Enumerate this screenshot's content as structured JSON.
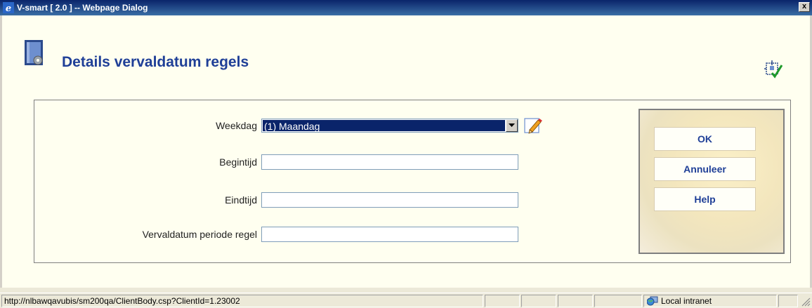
{
  "window": {
    "title": "V-smart [ 2.0 ] -- Webpage Dialog",
    "close_label": "x"
  },
  "page": {
    "title": "Details vervaldatum regels"
  },
  "form": {
    "weekdag": {
      "label": "Weekdag",
      "value": "(1) Maandag"
    },
    "begintijd": {
      "label": "Begintijd",
      "value": ""
    },
    "eindtijd": {
      "label": "Eindtijd",
      "value": ""
    },
    "periode": {
      "label": "Vervaldatum periode regel",
      "value": ""
    }
  },
  "buttons": {
    "ok": "OK",
    "annuleer": "Annuleer",
    "help": "Help"
  },
  "statusbar": {
    "url": "http://nlbawqavubis/sm200qa/ClientBody.csp?ClientId=1.23002",
    "zone": "Local intranet"
  },
  "icons": {
    "window": "ie-icon",
    "header": "settings-book-icon",
    "tool": "layout-check-icon",
    "edit": "pencil-icon",
    "zone": "globe-icon"
  },
  "colors": {
    "accent": "#1f3f97",
    "selection": "#0a246a",
    "background": "#fffff0"
  }
}
